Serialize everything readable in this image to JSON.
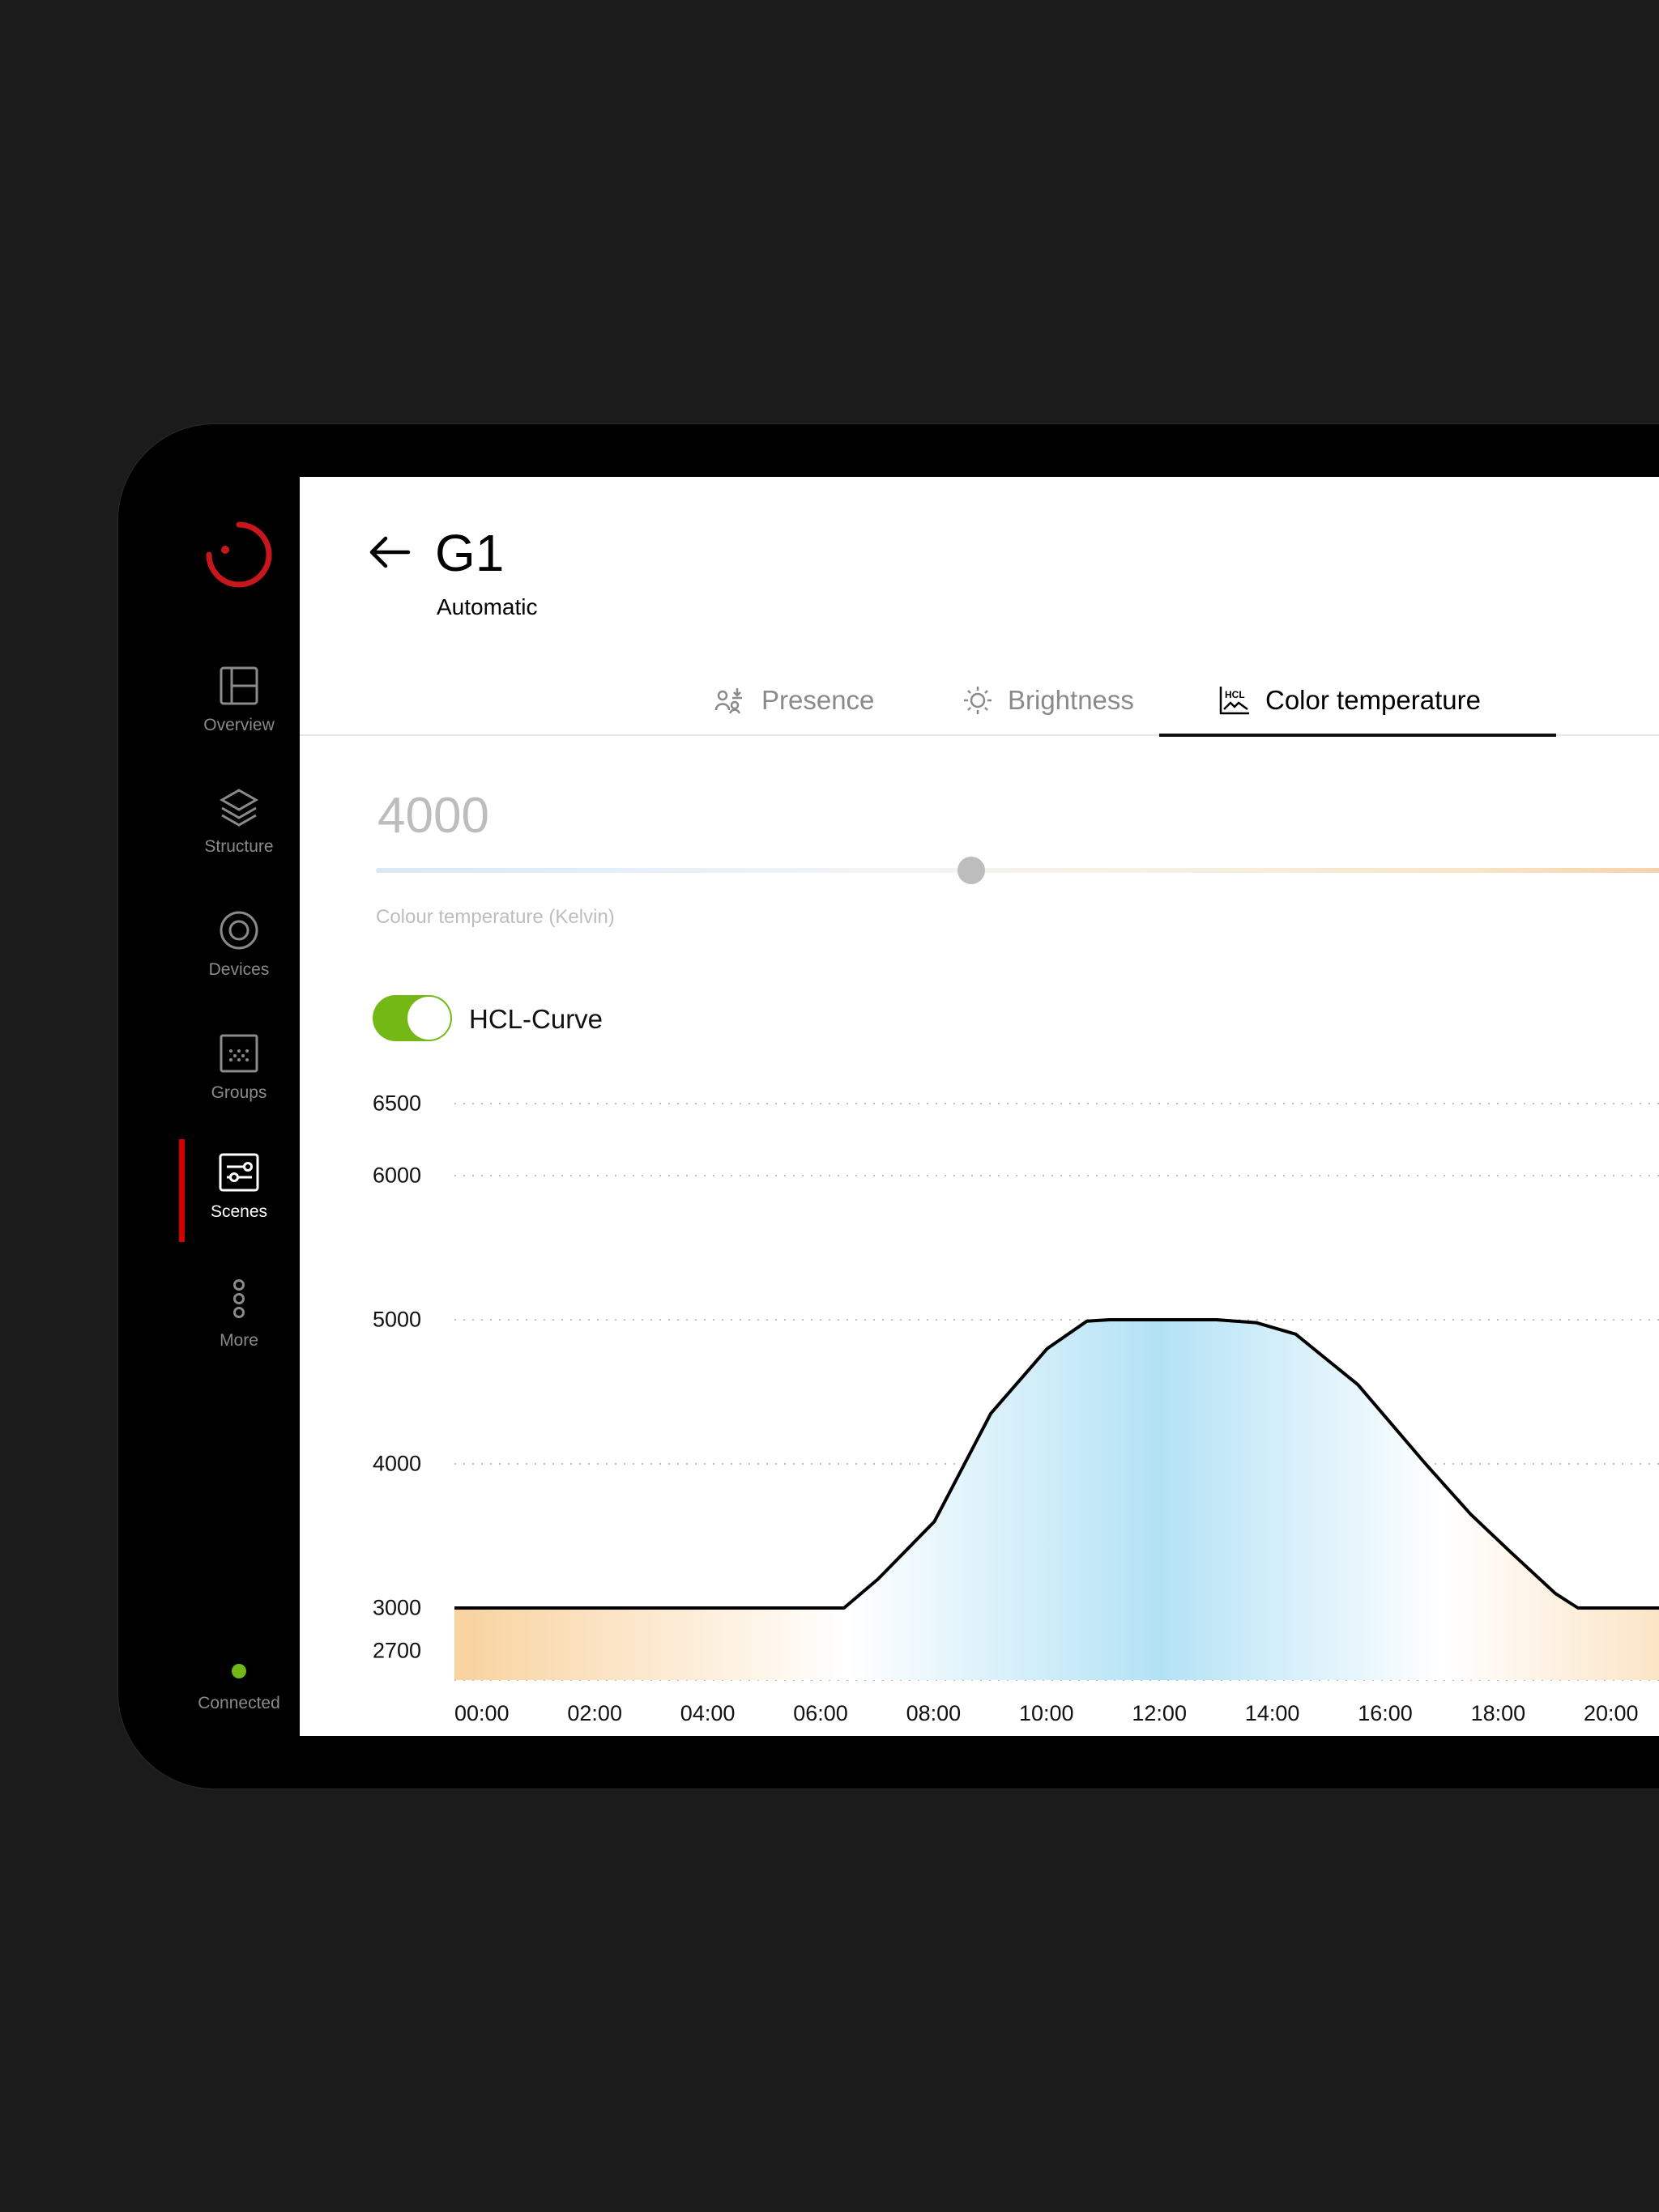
{
  "sidebar": {
    "items": [
      {
        "label": "Overview",
        "icon": "layout-icon"
      },
      {
        "label": "Structure",
        "icon": "layers-icon"
      },
      {
        "label": "Devices",
        "icon": "device-icon"
      },
      {
        "label": "Groups",
        "icon": "groups-icon"
      },
      {
        "label": "Scenes",
        "icon": "sliders-icon",
        "active": true
      },
      {
        "label": "More",
        "icon": "more-icon"
      }
    ],
    "status": {
      "label": "Connected",
      "color": "#74b816"
    },
    "brand_color": "#c8161d"
  },
  "header": {
    "title": "G1",
    "subtitle": "Automatic"
  },
  "tabs": [
    {
      "label": "Presence",
      "icon": "presence-icon"
    },
    {
      "label": "Brightness",
      "icon": "sun-icon"
    },
    {
      "label": "Color temperature",
      "icon": "hcl-curve-icon",
      "active": true
    }
  ],
  "slider": {
    "value": "4000",
    "label": "Colour temperature (Kelvin)",
    "min": 2500,
    "max": 6500,
    "current": 4000
  },
  "toggle": {
    "label": "HCL-Curve",
    "on": true,
    "color": "#74b816"
  },
  "chart_data": {
    "type": "area",
    "x_unit": "hour of day",
    "xlim": [
      0,
      24
    ],
    "ylim": [
      2500,
      6500
    ],
    "y_ticks": [
      "6500",
      "6000",
      "5000",
      "4000",
      "3000",
      "2700"
    ],
    "y_tick_values": [
      6500,
      6000,
      5000,
      4000,
      3000,
      2700
    ],
    "x_ticks": [
      "00:00",
      "02:00",
      "04:00",
      "06:00",
      "08:00",
      "10:00",
      "12:00",
      "14:00",
      "16:00",
      "18:00",
      "20:00"
    ],
    "x_tick_values": [
      0,
      2,
      4,
      6,
      8,
      10,
      12,
      14,
      16,
      18,
      20
    ],
    "grid": "horizontal dotted",
    "series": [
      {
        "x": [
          0,
          6.9,
          7.5,
          8.5,
          9.5,
          10.5,
          11.2,
          11.6,
          13.5,
          14.2,
          14.9,
          16.0,
          17.2,
          18.0,
          18.7,
          19.5,
          19.9,
          24
        ],
        "y": [
          3000,
          3000,
          3200,
          3600,
          4350,
          4800,
          4990,
          5000,
          5000,
          4980,
          4900,
          4550,
          4000,
          3650,
          3390,
          3100,
          3000,
          3000
        ]
      }
    ],
    "colors": {
      "warm": "#f8d29e",
      "cool": "#b3e2f5",
      "line": "#000000"
    }
  }
}
